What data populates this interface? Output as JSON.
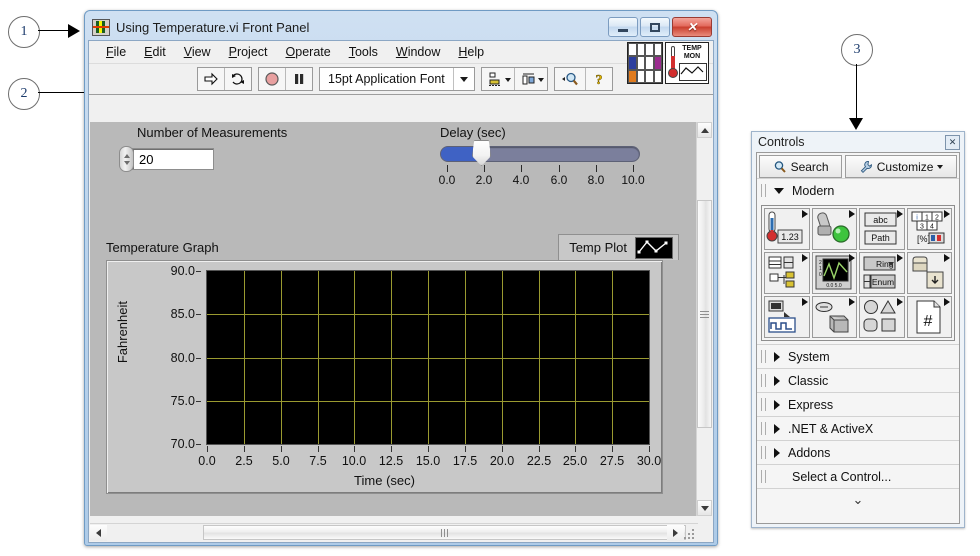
{
  "callouts": [
    {
      "id": "callout-1",
      "label": "1"
    },
    {
      "id": "callout-2",
      "label": "2"
    },
    {
      "id": "callout-3",
      "label": "3"
    }
  ],
  "window": {
    "title": "Using Temperature.vi Front Panel",
    "icon_name": "labview-vi-icon",
    "buttons": {
      "minimize": "minimize",
      "maximize": "maximize",
      "close": "close"
    }
  },
  "menubar": {
    "items": [
      {
        "label": "File",
        "mnemonic": "F"
      },
      {
        "label": "Edit",
        "mnemonic": "E"
      },
      {
        "label": "View",
        "mnemonic": "V"
      },
      {
        "label": "Project",
        "mnemonic": "P"
      },
      {
        "label": "Operate",
        "mnemonic": "O"
      },
      {
        "label": "Tools",
        "mnemonic": "T"
      },
      {
        "label": "Window",
        "mnemonic": "W"
      },
      {
        "label": "Help",
        "mnemonic": "H"
      }
    ],
    "vi_icon_text": {
      "line1": "TEMP",
      "line2": "MON"
    }
  },
  "toolbar": {
    "run_button": "run-arrow",
    "run_continuous_button": "run-continuously",
    "abort_button": "abort-execution",
    "pause_button": "pause",
    "font_selector": {
      "value": "15pt Application Font",
      "dropdown": "font-dropdown"
    },
    "align_objects": "align-objects",
    "distribute_objects": "distribute-objects",
    "reorder": "reorder-objects",
    "search": "search-button",
    "help": "context-help-button"
  },
  "panel": {
    "num_measurements": {
      "label": "Number of Measurements",
      "value": "20",
      "increment": "increment",
      "decrement": "decrement"
    },
    "delay": {
      "label": "Delay (sec)",
      "value": 2.0,
      "min": 0.0,
      "max": 10.0,
      "tick_labels": [
        "0.0",
        "2.0",
        "4.0",
        "6.0",
        "8.0",
        "10.0"
      ]
    },
    "graph": {
      "label": "Temperature Graph",
      "legend": {
        "plot_name": "Temp Plot",
        "plot_style_icon": "plot-style-icon"
      }
    },
    "scrollbars": {
      "vertical": "vertical-scrollbar",
      "horizontal": "horizontal-scrollbar"
    }
  },
  "chart_data": {
    "type": "line",
    "title": "Temperature Graph",
    "xlabel": "Time (sec)",
    "ylabel": "Fahrenheit",
    "xlim": [
      0.0,
      30.0
    ],
    "ylim": [
      70.0,
      90.0
    ],
    "xticks": [
      "0.0",
      "2.5",
      "5.0",
      "7.5",
      "10.0",
      "12.5",
      "15.0",
      "17.5",
      "20.0",
      "22.5",
      "25.0",
      "27.5",
      "30.0"
    ],
    "yticks": [
      "90.0",
      "85.0",
      "80.0",
      "75.0",
      "70.0"
    ],
    "grid": true,
    "grid_color": "#9a9a30",
    "plot_bg": "#000000",
    "legend": [
      "Temp Plot"
    ],
    "legend_position": "top-right",
    "series": [
      {
        "name": "Temp Plot",
        "x": [],
        "y": []
      }
    ]
  },
  "palette": {
    "title": "Controls",
    "close_label": "x",
    "tools": [
      {
        "label": "Search",
        "icon": "magnifier-icon"
      },
      {
        "label": "Customize",
        "icon": "wrench-icon",
        "has_dropdown": true
      }
    ],
    "categories": [
      {
        "label": "Modern",
        "expanded": true
      },
      {
        "label": "System",
        "expanded": false
      },
      {
        "label": "Classic",
        "expanded": false
      },
      {
        "label": "Express",
        "expanded": false
      },
      {
        "label": ".NET & ActiveX",
        "expanded": false
      },
      {
        "label": "Addons",
        "expanded": false
      }
    ],
    "select_control": "Select a Control...",
    "expand_chevron": "chevrons-down-icon",
    "modern_icons": [
      {
        "name": "numeric-palette-icon",
        "has_submenu": true
      },
      {
        "name": "boolean-palette-icon",
        "has_submenu": true
      },
      {
        "name": "string-path-palette-icon",
        "has_submenu": true
      },
      {
        "name": "array-matrix-cluster-palette-icon",
        "has_submenu": true
      },
      {
        "name": "list-table-tree-palette-icon",
        "has_submenu": true
      },
      {
        "name": "graph-palette-icon",
        "has_submenu": true
      },
      {
        "name": "ring-enum-palette-icon",
        "has_submenu": true
      },
      {
        "name": "containers-palette-icon",
        "has_submenu": true
      },
      {
        "name": "io-palette-icon",
        "has_submenu": true
      },
      {
        "name": "refnum-palette-icon",
        "has_submenu": true
      },
      {
        "name": "decorations-palette-icon",
        "has_submenu": true
      },
      {
        "name": "variant-class-palette-icon",
        "has_submenu": true
      }
    ]
  },
  "colors": {
    "slider_fill": "#3f62c4",
    "slider_track": "#7b7f9c",
    "plot_background": "#000000",
    "grid": "#9a9a30",
    "panel_background": "#b9b9b9",
    "window_chrome": "#bcd4ec"
  }
}
